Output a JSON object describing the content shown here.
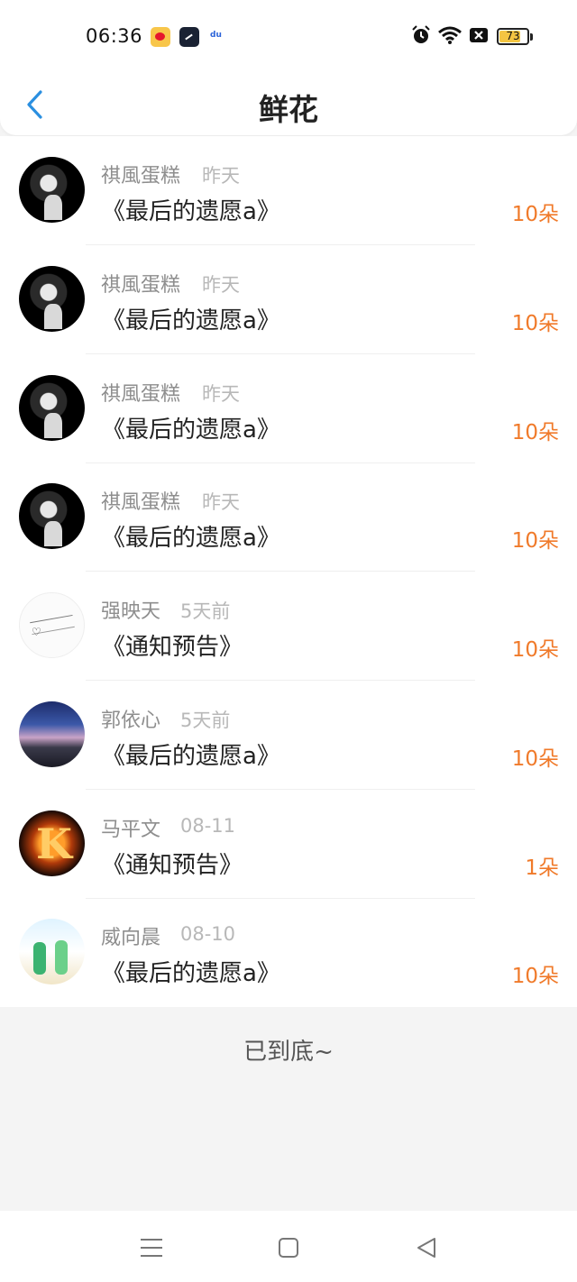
{
  "status_bar": {
    "time": "06:36",
    "battery": "73",
    "notification_icons": [
      "weibo-icon",
      "clock-app-icon",
      "baidu-icon"
    ],
    "system_icons": [
      "alarm-icon",
      "wifi-icon",
      "mute-icon",
      "battery-icon"
    ]
  },
  "header": {
    "title": "鲜花",
    "back_icon": "chevron-left-icon",
    "accent_color": "#2a8fe0"
  },
  "list": {
    "count_color": "#f07a2a",
    "items": [
      {
        "name": "祺風蛋糕",
        "time": "昨天",
        "title": "《最后的遗愿a》",
        "count": "10朵",
        "avatar": "dark-portrait"
      },
      {
        "name": "祺風蛋糕",
        "time": "昨天",
        "title": "《最后的遗愿a》",
        "count": "10朵",
        "avatar": "dark-portrait"
      },
      {
        "name": "祺風蛋糕",
        "time": "昨天",
        "title": "《最后的遗愿a》",
        "count": "10朵",
        "avatar": "dark-portrait"
      },
      {
        "name": "祺風蛋糕",
        "time": "昨天",
        "title": "《最后的遗愿a》",
        "count": "10朵",
        "avatar": "dark-portrait"
      },
      {
        "name": "强映天",
        "time": "5天前",
        "title": "《通知预告》",
        "count": "10朵",
        "avatar": "sketch"
      },
      {
        "name": "郭依心",
        "time": "5天前",
        "title": "《最后的遗愿a》",
        "count": "10朵",
        "avatar": "night-sky"
      },
      {
        "name": "马平文",
        "time": "08-11",
        "title": "《通知预告》",
        "count": "1朵",
        "avatar": "fire-letter-k"
      },
      {
        "name": "威向晨",
        "time": "08-10",
        "title": "《最后的遗愿a》",
        "count": "10朵",
        "avatar": "beach-couple"
      }
    ]
  },
  "footer": {
    "end_text": "已到底~"
  },
  "system_nav": {
    "icons": [
      "menu-icon",
      "home-icon",
      "back-triangle-icon"
    ]
  }
}
